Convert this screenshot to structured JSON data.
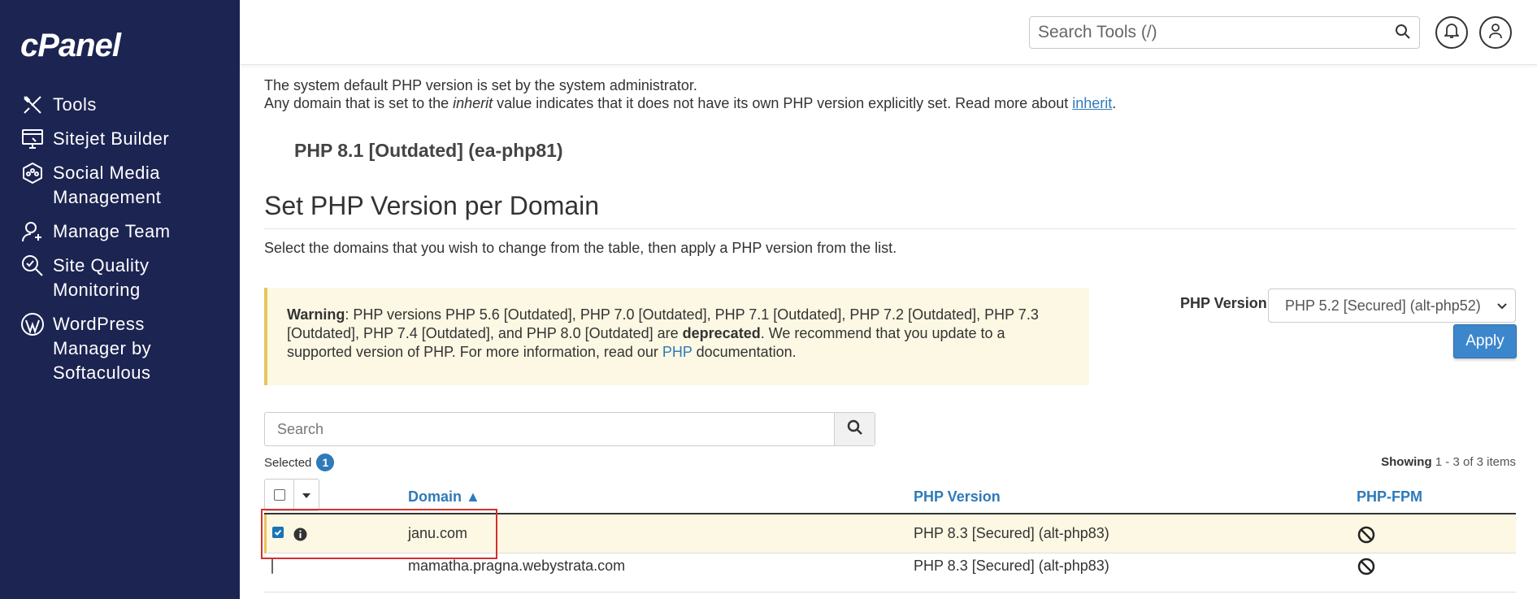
{
  "sidebar": {
    "logo": "cPanel",
    "items": [
      {
        "label": "Tools",
        "icon": "tools-icon"
      },
      {
        "label": "Sitejet Builder",
        "icon": "sitejet-icon"
      },
      {
        "label": "Social Media\nManagement",
        "icon": "social-media-icon"
      },
      {
        "label": "Manage Team",
        "icon": "manage-team-icon"
      },
      {
        "label": "Site Quality\nMonitoring",
        "icon": "site-quality-icon"
      },
      {
        "label": "WordPress\nManager by\nSoftaculous",
        "icon": "wordpress-icon"
      }
    ]
  },
  "header": {
    "search_placeholder": "Search Tools (/)"
  },
  "main": {
    "intro_line1": "The system default PHP version is set by the system administrator.",
    "intro_line2_pre": "Any domain that is set to the ",
    "intro_line2_em": "inherit",
    "intro_line2_post": " value indicates that it does not have its own PHP version explicitly set. Read more about ",
    "intro_link": "inherit",
    "intro_end": ".",
    "current_php": "PHP 8.1 [Outdated] (ea-php81)",
    "section_title": "Set PHP Version per Domain",
    "instructions": "Select the domains that you wish to change from the table, then apply a PHP version from the list.",
    "warning": {
      "label": "Warning",
      "text1": ": PHP versions PHP 5.6 [Outdated], PHP 7.0 [Outdated], PHP 7.1 [Outdated], PHP 7.2 [Outdated], PHP 7.3 [Outdated], PHP 7.4 [Outdated], and PHP 8.0 [Outdated] are ",
      "bold": "deprecated",
      "text2": ". We recommend that you update to a supported version of PHP. For more information, read our ",
      "link": "PHP",
      "text3": " documentation."
    },
    "php_version_label": "PHP Version",
    "php_version_selected": "PHP 5.2 [Secured] (alt-php52)",
    "apply_label": "Apply",
    "table_search_placeholder": "Search",
    "selected_label": "Selected",
    "selected_count": "1",
    "showing_label": "Showing",
    "showing_range": " 1 - 3 of 3 items",
    "columns": {
      "domain": "Domain ▲",
      "php_version": "PHP Version",
      "php_fpm": "PHP-FPM"
    },
    "rows": [
      {
        "domain": "janu.com",
        "php_version": "PHP 8.3 [Secured] (alt-php83)",
        "selected": true
      },
      {
        "domain": "mamatha.pragna.webystrata.com",
        "php_version": "PHP 8.3 [Secured] (alt-php83)",
        "selected": false
      }
    ]
  },
  "colors": {
    "sidebar_bg": "#1c2452",
    "accent": "#2f7ab9",
    "warning_bg": "#fcf8e3",
    "highlight": "#d23030"
  }
}
